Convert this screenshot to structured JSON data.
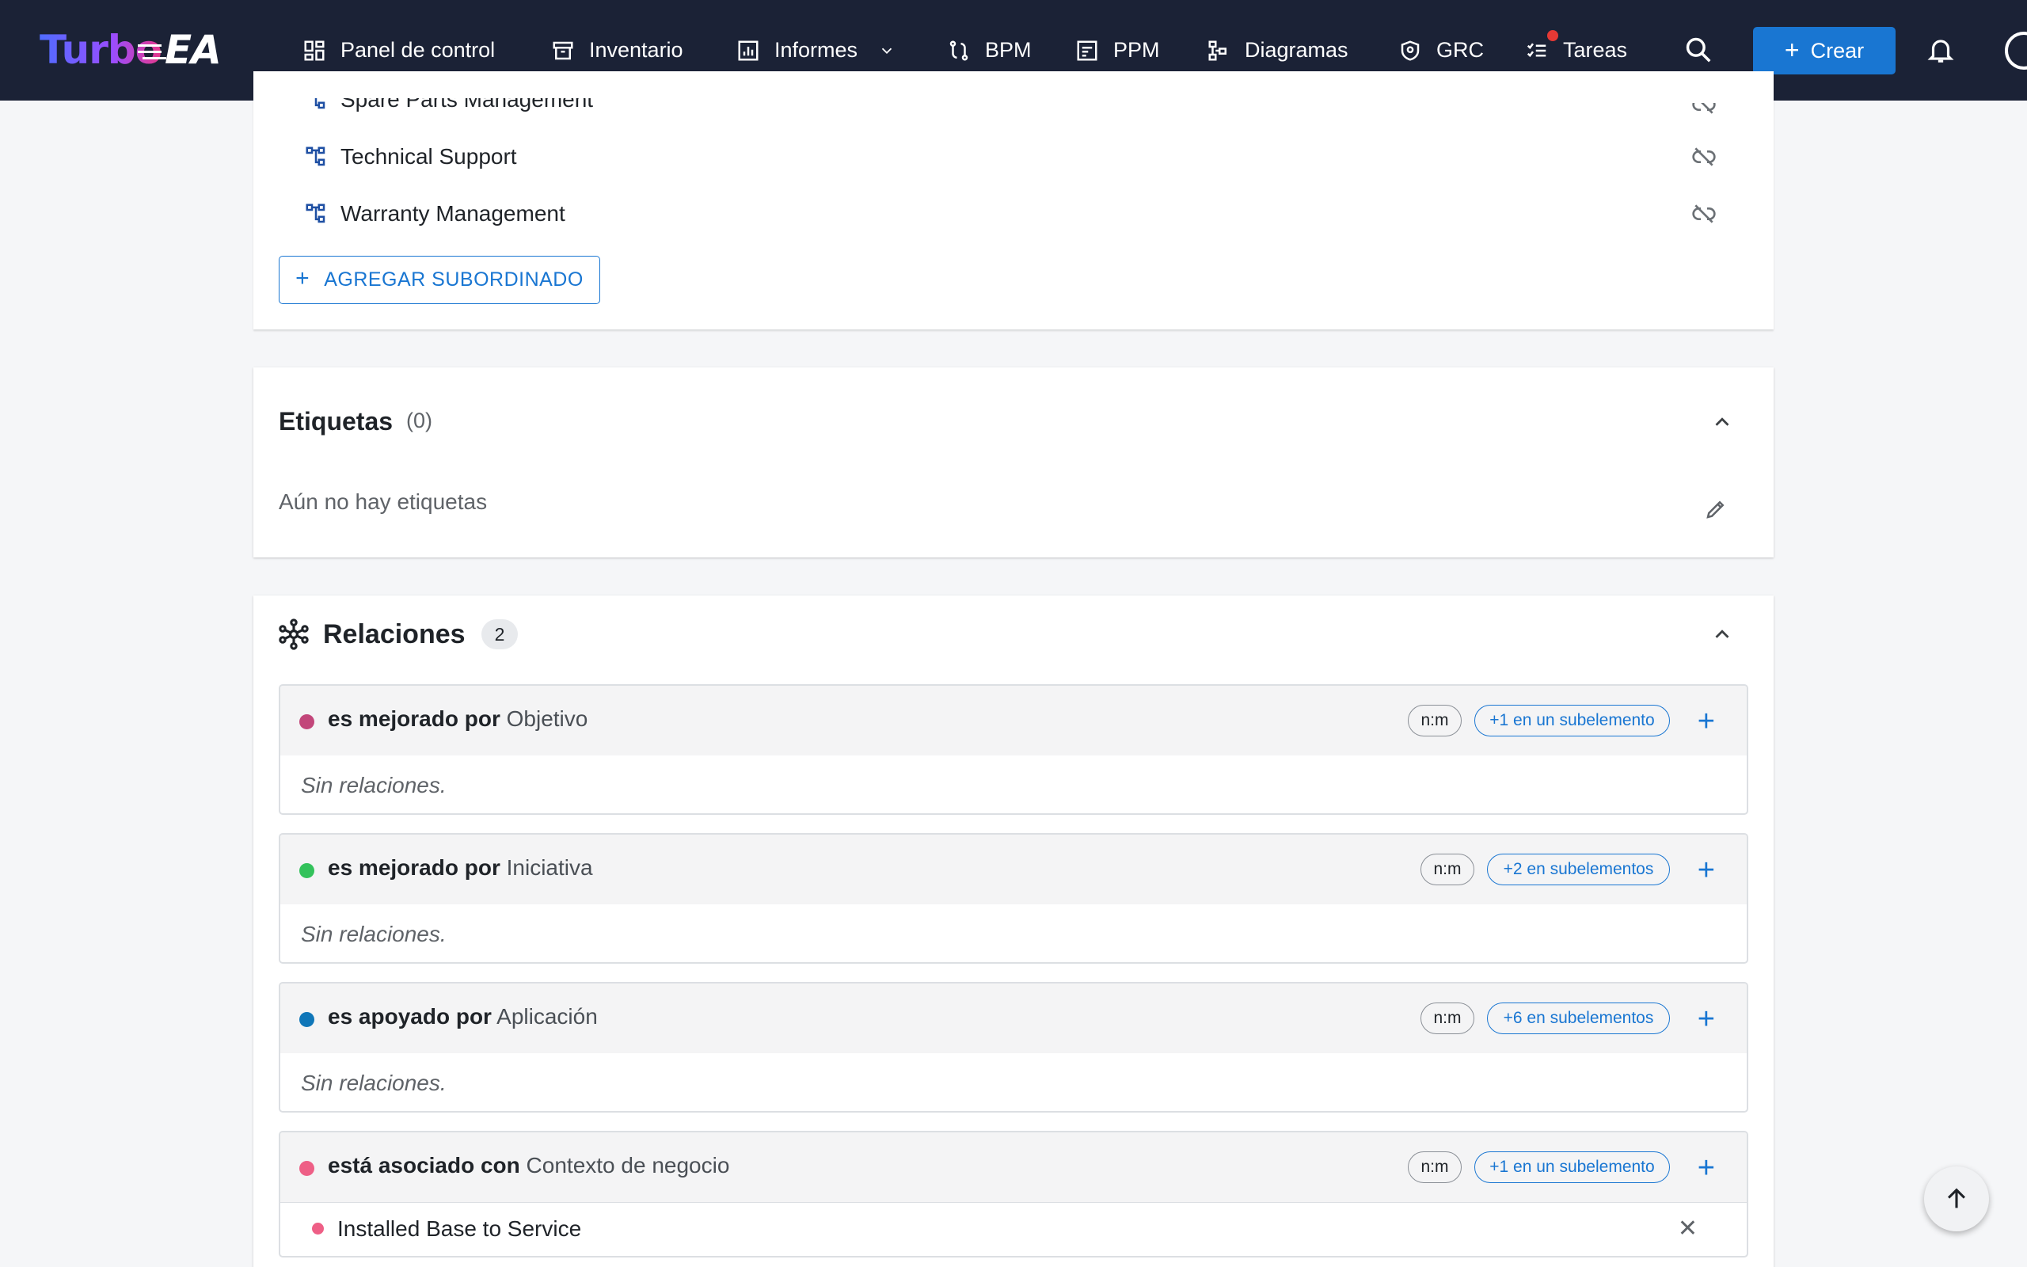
{
  "app": {
    "logo_part1": "Turbo",
    "logo_part2": "EA"
  },
  "nav": {
    "items": [
      {
        "label": "Panel de control",
        "icon": "dashboard-icon"
      },
      {
        "label": "Inventario",
        "icon": "archive-icon"
      },
      {
        "label": "Informes",
        "icon": "report-icon"
      },
      {
        "label": "BPM",
        "icon": "process-icon"
      },
      {
        "label": "PPM",
        "icon": "portfolio-icon"
      },
      {
        "label": "Diagramas",
        "icon": "diagram-icon"
      },
      {
        "label": "GRC",
        "icon": "shield-icon"
      },
      {
        "label": "Tareas",
        "icon": "tasks-icon"
      }
    ],
    "create_label": "Crear"
  },
  "children": {
    "items": [
      {
        "label": "Spare Parts Management"
      },
      {
        "label": "Technical Support"
      },
      {
        "label": "Warranty Management"
      }
    ],
    "add_label": "AGREGAR SUBORDINADO"
  },
  "tags": {
    "title": "Etiquetas",
    "count": "(0)",
    "empty_text": "Aún no hay etiquetas"
  },
  "relations": {
    "title": "Relaciones",
    "count": "2",
    "groups": [
      {
        "verb": "es mejorado por",
        "target": "Objetivo",
        "cardinality": "n:m",
        "sub_chip": "+1 en un subelemento",
        "empty": "Sin relaciones.",
        "dot_color": "#c2467a"
      },
      {
        "verb": "es mejorado por",
        "target": "Iniciativa",
        "cardinality": "n:m",
        "sub_chip": "+2 en subelementos",
        "empty": "Sin relaciones.",
        "dot_color": "#33c25b"
      },
      {
        "verb": "es apoyado por",
        "target": "Aplicación",
        "cardinality": "n:m",
        "sub_chip": "+6 en subelementos",
        "empty": "Sin relaciones.",
        "dot_color": "#0f76b8"
      },
      {
        "verb": "está asociado con",
        "target": "Contexto de negocio",
        "cardinality": "n:m",
        "sub_chip": "+1 en un subelemento",
        "dot_color": "#ee5f86",
        "items": [
          {
            "label": "Installed Base to Service",
            "dot_color": "#ee5f86"
          }
        ]
      }
    ]
  },
  "colors": {
    "topbar": "#1b2236",
    "accent": "#1976d2"
  }
}
